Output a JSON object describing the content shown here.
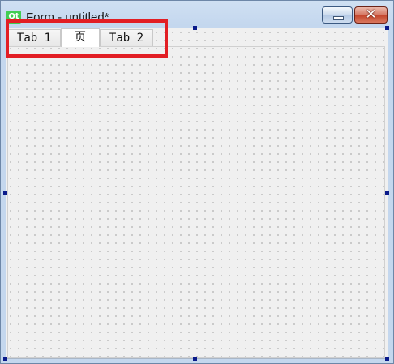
{
  "window": {
    "title": "Form - untitled*",
    "app_icon_text": "Qt"
  },
  "title_buttons": {
    "close_glyph": "✕"
  },
  "tabs": [
    {
      "label": "Tab 1"
    },
    {
      "label": "页"
    },
    {
      "label": "Tab 2"
    }
  ],
  "annotation": {
    "color": "#e21e24"
  },
  "colors": {
    "qt_icon": "#41cd52",
    "close_button": "#c3442b",
    "selection_handle": "#0a1a8a"
  }
}
